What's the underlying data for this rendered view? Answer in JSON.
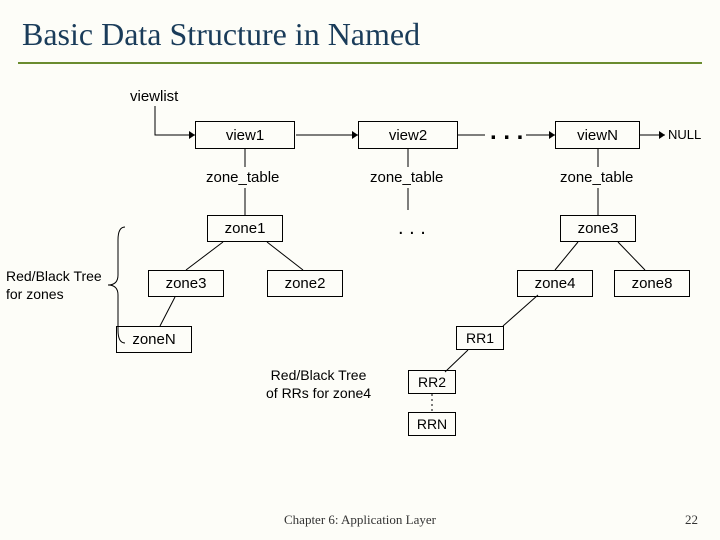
{
  "title": "Basic Data Structure in Named",
  "labels": {
    "viewlist": "viewlist",
    "view1": "view1",
    "view2": "view2",
    "viewN": "viewN",
    "null": "NULL",
    "zone_table": "zone_table",
    "zone1": "zone1",
    "zone2": "zone2",
    "zone3": "zone3",
    "zone4": "zone4",
    "zone8": "zone8",
    "zoneN": "zoneN",
    "rbtree_zones": "Red/Black Tree\nfor zones",
    "rbtree_rrs": "Red/Black Tree\nof RRs for zone4",
    "rr1": "RR1",
    "rr2": "RR2",
    "rrn": "RRN"
  },
  "footer": {
    "center": "Chapter 6: Application Layer",
    "page": "22"
  }
}
